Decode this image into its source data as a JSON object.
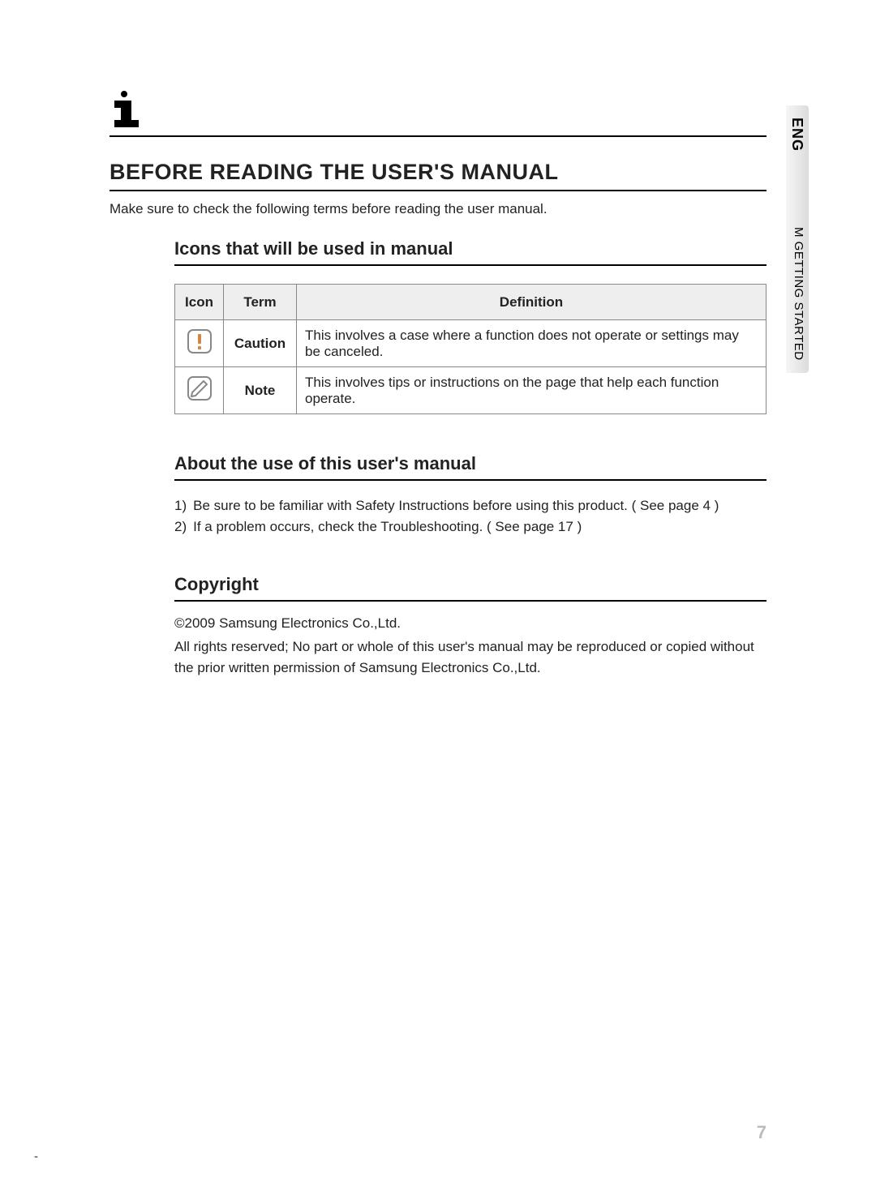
{
  "side": {
    "lang_label": "ENG",
    "section_label": "M GETTING STARTED"
  },
  "main": {
    "title": "BEFORE READING THE USER'S MANUAL",
    "intro": "Make sure to check the following terms before reading the user manual."
  },
  "icons_section": {
    "title": "Icons that will be used in manual",
    "headers": {
      "icon": "Icon",
      "term": "Term",
      "definition": "Definition"
    },
    "rows": [
      {
        "icon_name": "caution-icon",
        "term": "Caution",
        "definition": "This involves a case where a function does not operate or settings may be canceled."
      },
      {
        "icon_name": "note-icon",
        "term": "Note",
        "definition": "This involves tips or instructions on the page that help each function operate."
      }
    ]
  },
  "about_section": {
    "title": "About the use of this user's manual",
    "items": [
      {
        "num": "1)",
        "text": "Be sure to be familiar with Safety Instructions before using this product. ( See page 4 )"
      },
      {
        "num": "2)",
        "text": "If a problem occurs, check the Troubleshooting. ( See page 17 )"
      }
    ]
  },
  "copyright_section": {
    "title": "Copyright",
    "line1": "©2009 Samsung Electronics Co.,Ltd.",
    "line2": "All rights reserved; No part or whole of this user's manual may be reproduced or copied without the prior written permission of Samsung Electronics Co.,Ltd."
  },
  "page_number": "7",
  "footer_mark": "-"
}
